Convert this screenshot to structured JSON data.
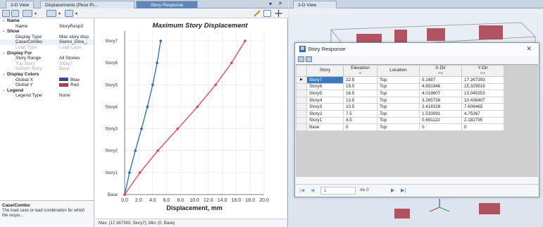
{
  "left_tabs": [
    {
      "label": "3-D View"
    },
    {
      "label": "Displacements (Peso Pr..."
    },
    {
      "label": "Story Response"
    }
  ],
  "left_tab_controls": {
    "pin": "▾",
    "close": "✕"
  },
  "right_tabs": [
    {
      "label": "3-D View"
    }
  ],
  "properties": [
    {
      "type": "section",
      "key": "Name"
    },
    {
      "type": "row",
      "key": "Name",
      "value": "StoryResp3"
    },
    {
      "type": "section",
      "key": "Show"
    },
    {
      "type": "row",
      "key": "Display Type",
      "value": "Max story disp"
    },
    {
      "type": "row",
      "key": "Case/Combo",
      "value": "Sismo_Dina_,"
    },
    {
      "type": "row",
      "key": "Load Type",
      "value": "Load Case",
      "dim": true
    },
    {
      "type": "section",
      "key": "Display For"
    },
    {
      "type": "row",
      "key": "Story Range",
      "value": "All Stories"
    },
    {
      "type": "row",
      "key": "Top Story",
      "value": "Story7",
      "dim": true
    },
    {
      "type": "row",
      "key": "Bottom Story",
      "value": "Base",
      "dim": true
    },
    {
      "type": "section",
      "key": "Display Colors"
    },
    {
      "type": "row",
      "key": "Global X",
      "value": "Blue",
      "swatch": "#1f4fa8"
    },
    {
      "type": "row",
      "key": "Global Y",
      "value": "Red",
      "swatch": "#e03040"
    },
    {
      "type": "section",
      "key": "Legend"
    },
    {
      "type": "row",
      "key": "Legend Type",
      "value": "None"
    }
  ],
  "description": {
    "title": "Case/Combo",
    "body": "The load case or load combination for which the respo..."
  },
  "statusbar": "Max: (17.367393, Story7);  Min: (0, Base)",
  "chart_data": {
    "type": "line",
    "title": "Maximum Story Displacement",
    "xlabel": "Displacement, mm",
    "ylabel": "",
    "xlim": [
      0,
      20
    ],
    "xticks": [
      "0.0",
      "2.0",
      "4.0",
      "6.0",
      "8.0",
      "10.0",
      "12.0",
      "14.0",
      "16.0",
      "18.0",
      "20.0"
    ],
    "categories": [
      "Base",
      "Story1",
      "Story2",
      "Story3",
      "Story4",
      "Story5",
      "Story6",
      "Story7"
    ],
    "grid": true,
    "series": [
      {
        "name": "Global X",
        "color": "#1f6fc4",
        "values": [
          0,
          0.691122,
          1.533091,
          2.418328,
          3.265736,
          4.019607,
          4.651946,
          5.1687
        ]
      },
      {
        "name": "Global Y",
        "color": "#e8404f",
        "values": [
          0,
          2.182795,
          4.75367,
          7.606465,
          10.436407,
          13.045353,
          15.329516,
          17.267393
        ]
      }
    ]
  },
  "dialog": {
    "title": "Story Response",
    "close": "✕",
    "columns": [
      {
        "label": "Story",
        "unit": ""
      },
      {
        "label": "Elevation",
        "unit": "m"
      },
      {
        "label": "Location",
        "unit": ""
      },
      {
        "label": "X-Dir",
        "unit": "mm"
      },
      {
        "label": "Y-Dir",
        "unit": "mm"
      }
    ],
    "rows": [
      {
        "marker": "▶",
        "story": "Story7",
        "elevation": "22.5",
        "location": "Top",
        "x": "5.1687",
        "y": "17.267393"
      },
      {
        "marker": "",
        "story": "Story6",
        "elevation": "19.5",
        "location": "Top",
        "x": "4.651946",
        "y": "15.329516"
      },
      {
        "marker": "",
        "story": "Story5",
        "elevation": "16.5",
        "location": "Top",
        "x": "4.019607",
        "y": "13.045353"
      },
      {
        "marker": "",
        "story": "Story4",
        "elevation": "13.5",
        "location": "Top",
        "x": "3.265736",
        "y": "10.436407"
      },
      {
        "marker": "",
        "story": "Story3",
        "elevation": "10.5",
        "location": "Top",
        "x": "2.418328",
        "y": "7.606465"
      },
      {
        "marker": "",
        "story": "Story2",
        "elevation": "7.5",
        "location": "Top",
        "x": "1.533091",
        "y": "4.75367"
      },
      {
        "marker": "",
        "story": "Story1",
        "elevation": "4.5",
        "location": "Top",
        "x": "0.691122",
        "y": "2.182795"
      },
      {
        "marker": "",
        "story": "Base",
        "elevation": "0",
        "location": "Top",
        "x": "0",
        "y": "0"
      }
    ],
    "nav": {
      "first": "|◀",
      "prev": "◀",
      "page": "1",
      "of": "de 0",
      "next": "▶",
      "last": "▶|"
    }
  }
}
